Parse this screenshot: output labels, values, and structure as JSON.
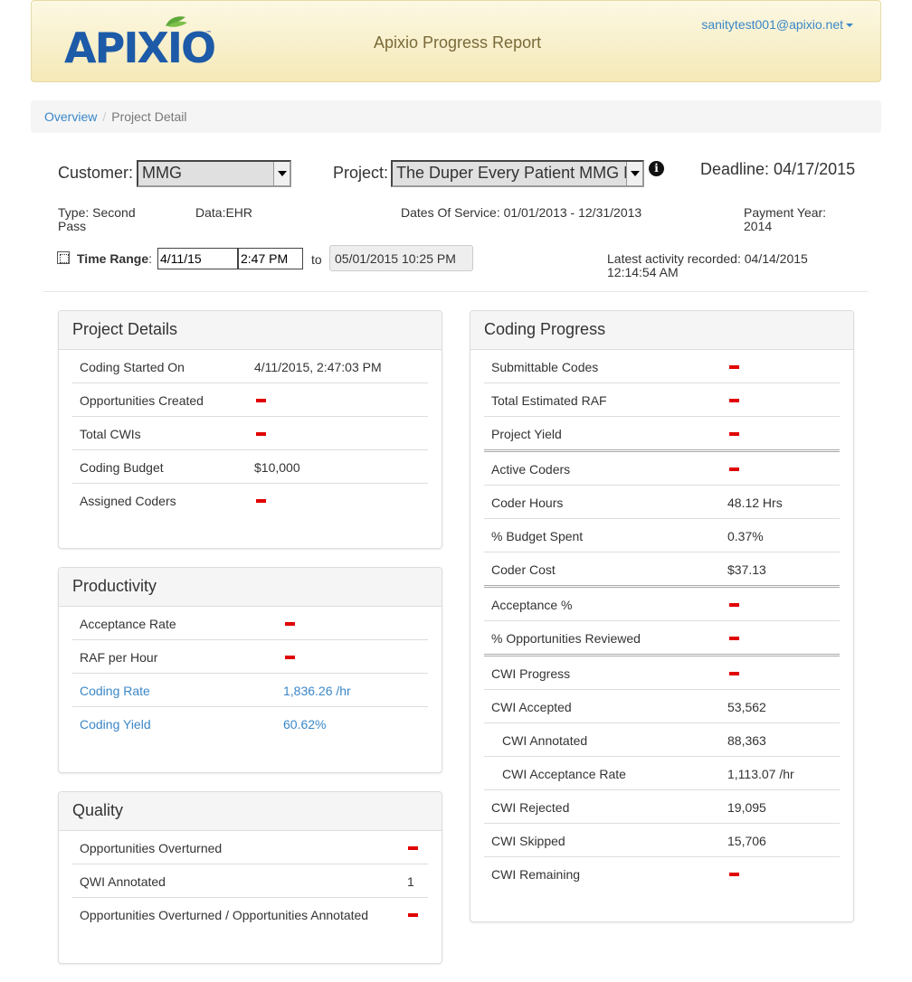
{
  "header": {
    "logo_text": "APIXIO",
    "title": "Apixio Progress Report",
    "user": "sanitytest001@apixio.net"
  },
  "breadcrumb": {
    "overview": "Overview",
    "current": "Project Detail"
  },
  "filters": {
    "customer_label": "Customer:",
    "customer_value": "MMG",
    "project_label": "Project:",
    "project_value": "The Duper Every Patient MMG Pro",
    "deadline": "Deadline: 04/17/2015"
  },
  "meta": {
    "type": "Type: Second Pass",
    "data": "Data:EHR",
    "dates_of_service": "Dates Of Service: 01/01/2013 - 12/31/2013",
    "payment_year": "Payment Year: 2014"
  },
  "time_range": {
    "label": "Time Range",
    "start_date": "4/11/15",
    "start_time": "2:47 PM",
    "to": "to",
    "end": "05/01/2015    10:25 PM",
    "latest_activity": "Latest activity recorded: 04/14/2015 12:14:54 AM"
  },
  "project_details": {
    "title": "Project Details",
    "rows": [
      {
        "label": "Coding Started On",
        "value": "4/11/2015, 2:47:03 PM"
      },
      {
        "label": "Opportunities Created",
        "value": ""
      },
      {
        "label": "Total CWIs",
        "value": ""
      },
      {
        "label": "Coding Budget",
        "value": "$10,000"
      },
      {
        "label": "Assigned Coders",
        "value": ""
      }
    ]
  },
  "productivity": {
    "title": "Productivity",
    "rows": [
      {
        "label": "Acceptance Rate",
        "value": ""
      },
      {
        "label": "RAF per Hour",
        "value": ""
      },
      {
        "label": "Coding Rate",
        "value": "1,836.26 /hr"
      },
      {
        "label": "Coding Yield",
        "value": "60.62%"
      }
    ]
  },
  "quality": {
    "title": "Quality",
    "rows": [
      {
        "label": "Opportunities Overturned",
        "value": ""
      },
      {
        "label": "QWI Annotated",
        "value": "1"
      },
      {
        "label": "Opportunities Overturned / Opportunities Annotated",
        "value": ""
      }
    ]
  },
  "coding_progress": {
    "title": "Coding Progress",
    "rows": [
      {
        "label": "Submittable Codes",
        "value": ""
      },
      {
        "label": "Total Estimated RAF",
        "value": ""
      },
      {
        "label": "Project Yield",
        "value": ""
      },
      {
        "label": "Active Coders",
        "value": ""
      },
      {
        "label": "Coder Hours",
        "value": "48.12 Hrs"
      },
      {
        "label": "% Budget Spent",
        "value": "0.37%"
      },
      {
        "label": "Coder Cost",
        "value": "$37.13"
      },
      {
        "label": "Acceptance %",
        "value": ""
      },
      {
        "label": "% Opportunities Reviewed",
        "value": ""
      },
      {
        "label": "CWI Progress",
        "value": ""
      },
      {
        "label": "CWI Accepted",
        "value": "53,562"
      },
      {
        "label": "CWI Annotated",
        "value": "88,363"
      },
      {
        "label": "CWI Acceptance Rate",
        "value": "1,113.07 /hr"
      },
      {
        "label": "CWI Rejected",
        "value": "19,095"
      },
      {
        "label": "CWI Skipped",
        "value": "15,706"
      },
      {
        "label": "CWI Remaining",
        "value": ""
      }
    ]
  },
  "colors": {
    "link": "#3a87c8",
    "missing_dash": "#e00000",
    "header_bg": "#fcf8e3"
  },
  "icons": {
    "info": "info-circle-icon",
    "dropdown": "caret-down-icon",
    "missing": "red-dash-icon"
  }
}
